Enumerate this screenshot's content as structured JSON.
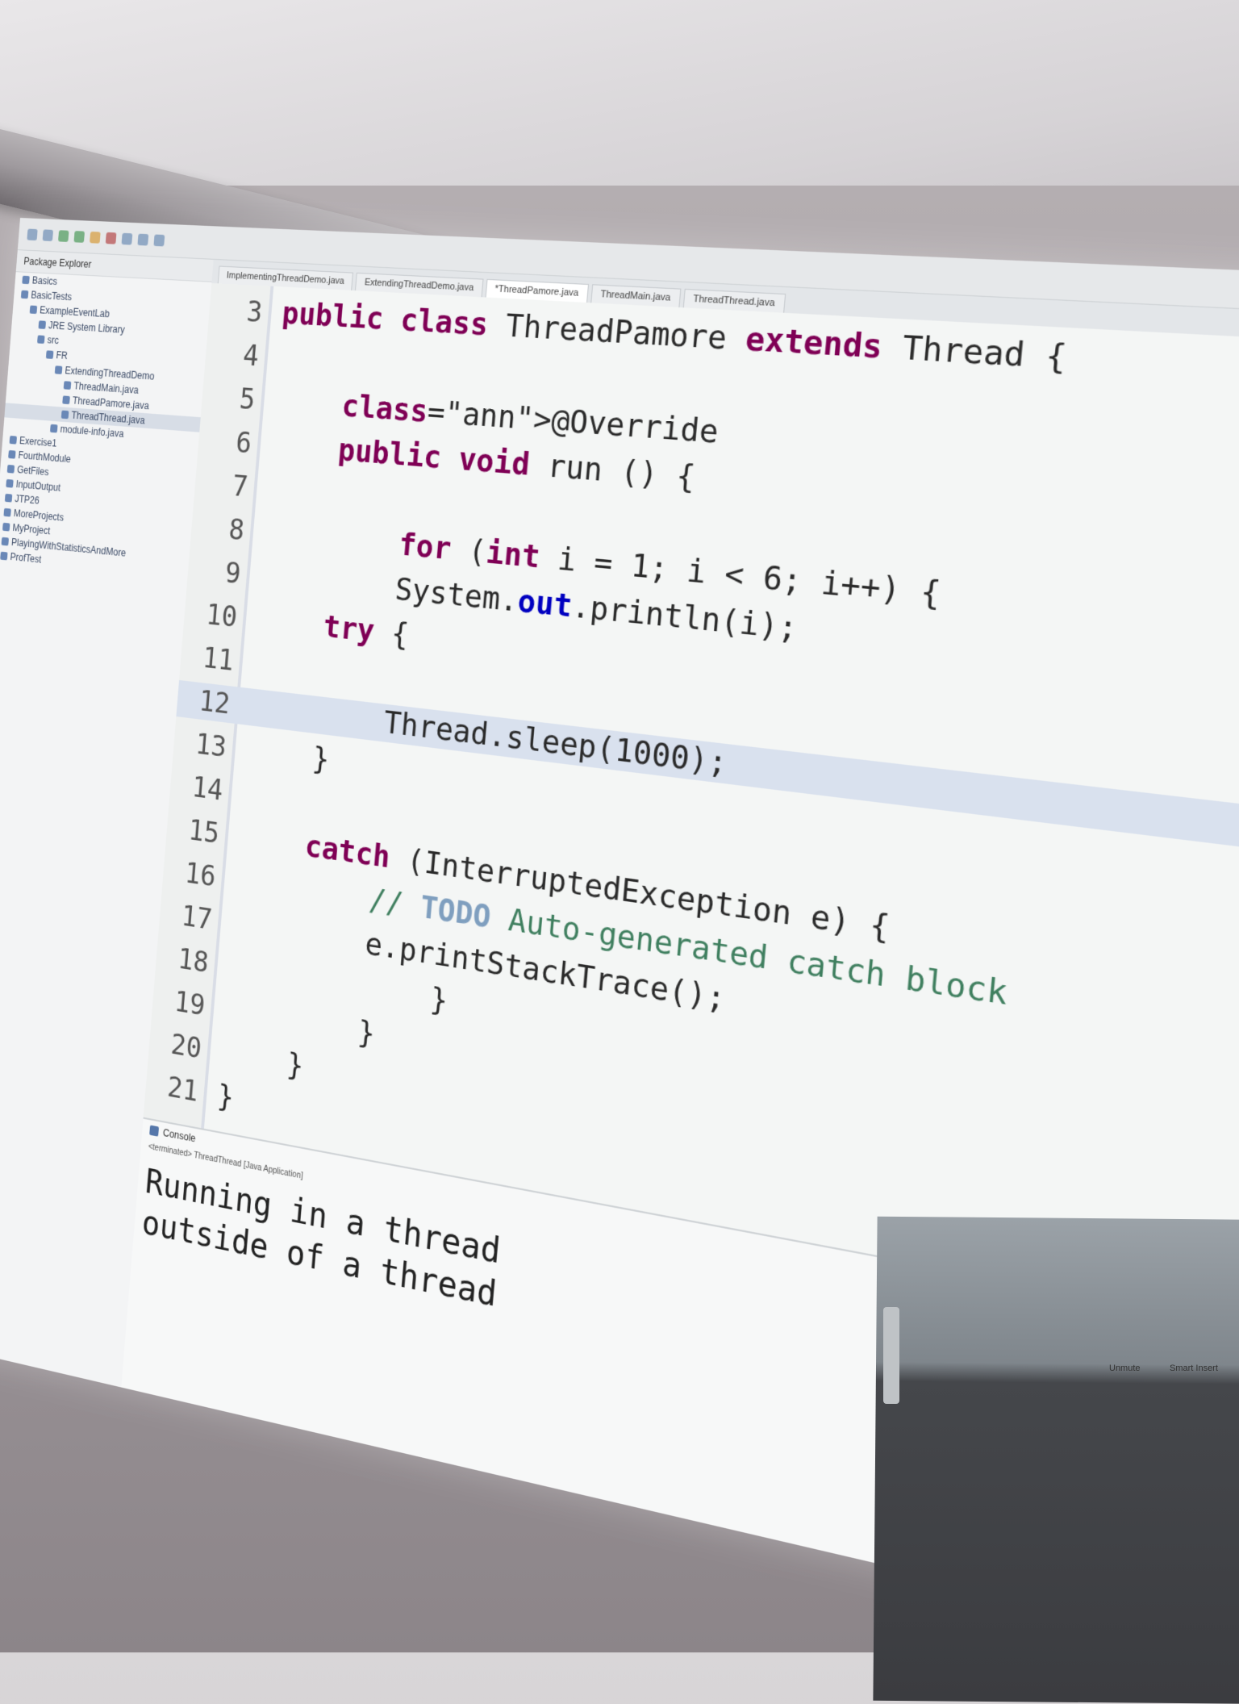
{
  "explorer": {
    "title": "Package Explorer",
    "items": [
      "Basics",
      "BasicTests",
      "ExampleEventLab",
      "JRE System Library",
      "src",
      "FR",
      "ExtendingThreadDemo",
      "ThreadMain.java",
      "ThreadPamore.java",
      "ThreadThread.java",
      "module-info.java",
      "Exercise1",
      "FourthModule",
      "GetFiles",
      "InputOutput",
      "JTP26",
      "MoreProjects",
      "MyProject",
      "PlayingWithStatisticsAndMore",
      "ProfTest"
    ]
  },
  "tabs": [
    "ImplementingThreadDemo.java",
    "ExtendingThreadDemo.java",
    "*ThreadPamore.java",
    "ThreadMain.java",
    "ThreadThread.java"
  ],
  "editor": {
    "lines": [
      {
        "num": "3",
        "code": "public class ThreadPamore extends Thread {"
      },
      {
        "num": "4",
        "code": ""
      },
      {
        "num": "5",
        "code": "    @Override"
      },
      {
        "num": "6",
        "code": "    public void run () {"
      },
      {
        "num": "7",
        "code": ""
      },
      {
        "num": "8",
        "code": "        for (int i = 1; i < 6; i++) {"
      },
      {
        "num": "9",
        "code": "        System.out.println(i);"
      },
      {
        "num": "10",
        "code": "    try {"
      },
      {
        "num": "11",
        "code": ""
      },
      {
        "num": "12",
        "code": "        Thread.sleep(1000);"
      },
      {
        "num": "13",
        "code": "    }"
      },
      {
        "num": "14",
        "code": ""
      },
      {
        "num": "15",
        "code": "    catch (InterruptedException e) {"
      },
      {
        "num": "16",
        "code": "        // TODO Auto-generated catch block"
      },
      {
        "num": "17",
        "code": "        e.printStackTrace();"
      },
      {
        "num": "18",
        "code": "            }"
      },
      {
        "num": "19",
        "code": "        }"
      },
      {
        "num": "20",
        "code": "    }"
      },
      {
        "num": "21",
        "code": "}"
      }
    ]
  },
  "console": {
    "tab_label": "Console",
    "status": "<terminated> ThreadThread [Java Application]",
    "output": [
      "Running in a thread",
      "outside of a thread"
    ]
  },
  "panel": {
    "label_left": "Unmute",
    "label_right": "Smart Insert"
  }
}
